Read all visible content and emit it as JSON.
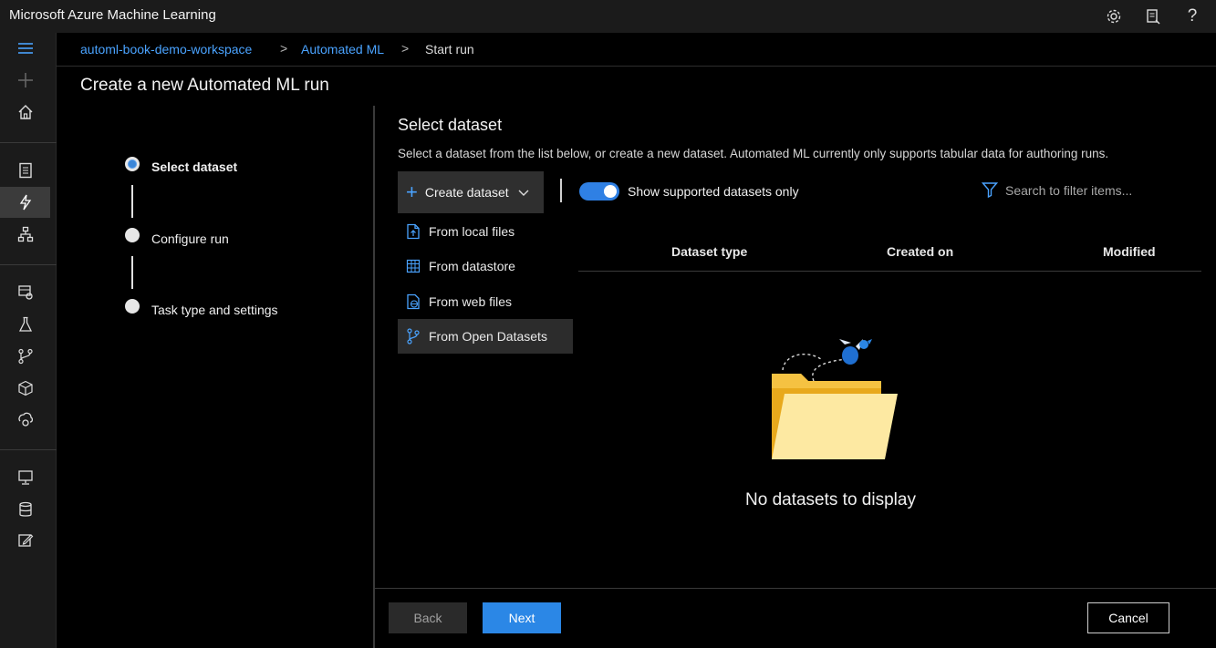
{
  "app": {
    "title": "Microsoft Azure Machine Learning"
  },
  "topbar_icons": [
    "settings-icon",
    "feedback-icon",
    "help-icon"
  ],
  "breadcrumb": {
    "items": [
      "automl-book-demo-workspace",
      "Automated ML"
    ],
    "current": "Start run",
    "separator": ">"
  },
  "page": {
    "title": "Create a new Automated ML run"
  },
  "steps": [
    {
      "label": "Select dataset",
      "state": "current"
    },
    {
      "label": "Configure run",
      "state": "pending"
    },
    {
      "label": "Task type and settings",
      "state": "pending"
    }
  ],
  "dataset": {
    "title": "Select dataset",
    "description": "Select a dataset from the list below, or create a new dataset. Automated ML currently only supports tabular data for authoring runs.",
    "create_label": "Create dataset",
    "toggle_label": "Show supported datasets only",
    "toggle_on": true,
    "search_placeholder": "Search to filter items...",
    "menu": [
      {
        "label": "From local files",
        "icon": "file-upload-icon"
      },
      {
        "label": "From datastore",
        "icon": "table-grid-icon"
      },
      {
        "label": "From web files",
        "icon": "web-file-icon"
      },
      {
        "label": "From Open Datasets",
        "icon": "open-datasets-icon"
      }
    ],
    "columns": [
      "Dataset type",
      "Created on",
      "Modified"
    ],
    "empty_message": "No datasets to display"
  },
  "footer": {
    "back": "Back",
    "next": "Next",
    "cancel": "Cancel"
  },
  "colors": {
    "accent": "#2b87e6",
    "link": "#4aa3ff",
    "folder": "#f6d776"
  }
}
